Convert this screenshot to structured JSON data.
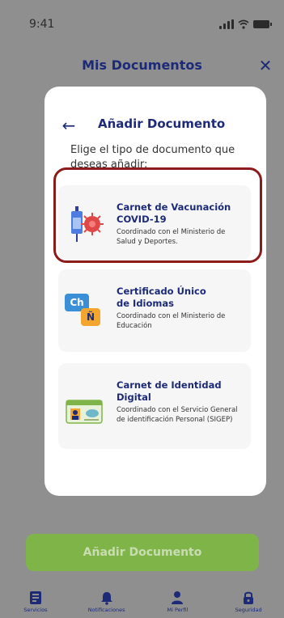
{
  "status_bar": {
    "time": "9:41"
  },
  "header": {
    "title": "Mis Documentos",
    "close_icon": "close-icon"
  },
  "modal": {
    "title": "Añadir Documento",
    "subtitle": "Elige el tipo de documento que deseas añadir:",
    "documents": [
      {
        "title_line1": "Carnet de Vacunación",
        "title_line2": "COVID-19",
        "description": "Coordinado con el Ministerio de Salud y Deportes.",
        "icon": "vaccine-icon"
      },
      {
        "title_line1": "Certificado Único",
        "title_line2": "de Idiomas",
        "description": "Coordinado con el Ministerio de Educación",
        "icon": "language-icon",
        "icon_text_1": "Ch",
        "icon_text_2": "Ñ"
      },
      {
        "title_line1": "Carnet de Identidad Digital",
        "description": "Coordinado con el Servicio General de identificación Personal (SIGEP)",
        "icon": "id-card-icon"
      }
    ]
  },
  "primary_button": {
    "label": "Añadir Documento"
  },
  "tabs": [
    {
      "label": "Servicios",
      "icon": "services-icon"
    },
    {
      "label": "Notificaciones",
      "icon": "bell-icon"
    },
    {
      "label": "Mi Perfil",
      "icon": "profile-icon"
    },
    {
      "label": "Seguridad",
      "icon": "lock-icon"
    }
  ],
  "colors": {
    "brand_blue": "#1d2a78",
    "button_green": "#7fb548",
    "highlight_red": "#8c1c1c",
    "overlay_gray": "#8f8f8f"
  }
}
